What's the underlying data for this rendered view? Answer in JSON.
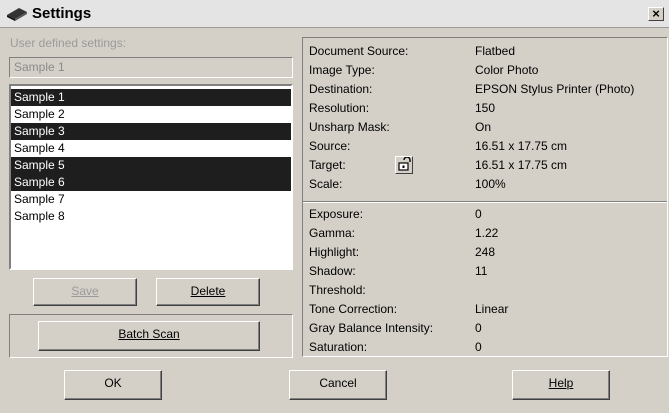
{
  "window": {
    "title": "Settings",
    "close_glyph": "×"
  },
  "left": {
    "user_defined_label": "User defined settings:",
    "name_value": "Sample 1",
    "samples": [
      {
        "label": "Sample 1",
        "selected": true
      },
      {
        "label": "Sample 2",
        "selected": false
      },
      {
        "label": "Sample 3",
        "selected": true
      },
      {
        "label": "Sample 4",
        "selected": false
      },
      {
        "label": "Sample 5",
        "selected": true
      },
      {
        "label": "Sample 6",
        "selected": true
      },
      {
        "label": "Sample 7",
        "selected": false
      },
      {
        "label": "Sample 8",
        "selected": false
      }
    ],
    "save_label": "Save",
    "delete_label": "Delete",
    "batch_scan_label": "Batch Scan"
  },
  "info": {
    "top": [
      {
        "key": "Document Source:",
        "value": "Flatbed"
      },
      {
        "key": "Image Type:",
        "value": "Color Photo"
      },
      {
        "key": "Destination:",
        "value": "EPSON Stylus Printer (Photo)"
      },
      {
        "key": "Resolution:",
        "value": "150"
      },
      {
        "key": "Unsharp Mask:",
        "value": "On"
      },
      {
        "key": "Source:",
        "value": "16.51 x 17.75 cm"
      },
      {
        "key": "Target:",
        "value": "16.51 x 17.75 cm"
      },
      {
        "key": "Scale:",
        "value": "100%"
      }
    ],
    "bottom": [
      {
        "key": "Exposure:",
        "value": "0"
      },
      {
        "key": " Gamma:",
        "value": "1.22"
      },
      {
        "key": "Highlight:",
        "value": "248"
      },
      {
        "key": "Shadow:",
        "value": "11"
      },
      {
        "key": "Threshold:",
        "value": ""
      },
      {
        "key": "Tone Correction:",
        "value": "Linear"
      },
      {
        "key": "Gray Balance Intensity:",
        "value": "0"
      },
      {
        "key": "Saturation:",
        "value": "0"
      }
    ]
  },
  "footer": {
    "ok_label": "OK",
    "cancel_label": "Cancel",
    "help_label": "Help"
  },
  "icons": {
    "app": "scanner-icon",
    "lock": "lock-icon"
  }
}
